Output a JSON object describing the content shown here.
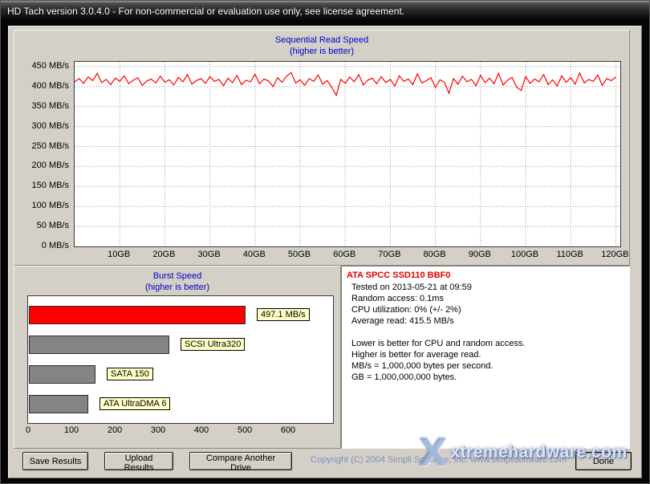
{
  "window": {
    "title": "HD Tach version 3.0.4.0  -  For non-commercial or evaluation use only, see license agreement."
  },
  "chart_data": [
    {
      "type": "line",
      "title": "Sequential Read Speed",
      "subtitle": "(higher is better)",
      "x_unit": "GB",
      "xlim": [
        0,
        121
      ],
      "x_tick_values": [
        10,
        20,
        30,
        40,
        50,
        60,
        70,
        80,
        90,
        100,
        110,
        120
      ],
      "x_tick_labels": [
        "10GB",
        "20GB",
        "30GB",
        "40GB",
        "50GB",
        "60GB",
        "70GB",
        "80GB",
        "90GB",
        "100GB",
        "110GB",
        "120GB"
      ],
      "ylim": [
        0,
        462
      ],
      "y_tick_values": [
        450,
        400,
        350,
        300,
        250,
        200,
        150,
        100,
        50,
        0
      ],
      "y_tick_labels": [
        "450 MB/s",
        "400 MB/s",
        "350 MB/s",
        "300 MB/s",
        "250 MB/s",
        "200 MB/s",
        "150 MB/s",
        "100 MB/s",
        "50 MB/s",
        "0 MB/s"
      ],
      "grid": "dotted",
      "line_color": "#ff0000",
      "series": [
        {
          "name": "Sequential read speed (MB/s)",
          "values": [
            412,
            420,
            408,
            424,
            415,
            433,
            410,
            418,
            405,
            421,
            413,
            427,
            407,
            416,
            422,
            403,
            414,
            419,
            409,
            426,
            411,
            417,
            404,
            423,
            412,
            430,
            406,
            415,
            420,
            408,
            425,
            413,
            418,
            402,
            421,
            410,
            428,
            405,
            416,
            412,
            431,
            407,
            419,
            414,
            400,
            422,
            411,
            426,
            435,
            409,
            417,
            403,
            420,
            413,
            429,
            406,
            415,
            399,
            378,
            418,
            408,
            424,
            412,
            430,
            404,
            416,
            421,
            407,
            425,
            410,
            418,
            401,
            427,
            413,
            419,
            405,
            432,
            409,
            415,
            422,
            398,
            417,
            411,
            383,
            420,
            406,
            426,
            412,
            418,
            402,
            428,
            410,
            421,
            407,
            433,
            404,
            416,
            423,
            399,
            390,
            425,
            408,
            419,
            412,
            430,
            405,
            417,
            401,
            427,
            411,
            422,
            406,
            434,
            409,
            418,
            413,
            429,
            403,
            420,
            415,
            424
          ]
        }
      ]
    },
    {
      "type": "bar",
      "orientation": "horizontal",
      "title": "Burst Speed",
      "subtitle": "(higher is better)",
      "xlim": [
        0,
        703
      ],
      "x_tick_values": [
        0,
        100,
        200,
        300,
        400,
        500,
        600
      ],
      "bars": [
        {
          "label": "497.1 MB/s",
          "value": 497.1,
          "color": "#ff0000"
        },
        {
          "label": "SCSI Ultra320",
          "value": 320,
          "color": "#848484"
        },
        {
          "label": "SATA 150",
          "value": 150,
          "color": "#848484"
        },
        {
          "label": "ATA UltraDMA 6",
          "value": 133,
          "color": "#848484"
        }
      ]
    }
  ],
  "info": {
    "title": "ATA SPCC SSD110 BBF0",
    "lines": [
      "Tested on 2013-05-21 at 09:59",
      "Random access: 0.1ms",
      "CPU utilization: 0% (+/- 2%)",
      "Average read: 415.5 MB/s",
      "",
      "Lower is better for CPU and random access.",
      "Higher is better for average read.",
      "MB/s = 1,000,000 bytes per second.",
      "GB = 1,000,000,000 bytes."
    ]
  },
  "buttons": {
    "save": "Save Results",
    "upload": "Upload Results",
    "compare": "Compare Another Drive",
    "done": "Done"
  },
  "footer": {
    "copyright": "Copyright (C) 2004 Simpli Software, Inc.  www.simplisoftware.com"
  },
  "watermark": {
    "logo": "X",
    "text": "xtremehardware.com"
  }
}
